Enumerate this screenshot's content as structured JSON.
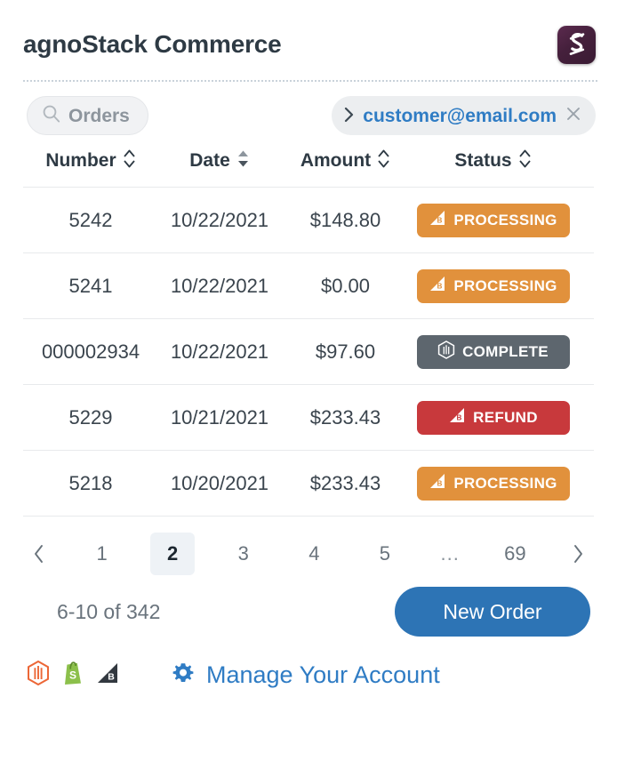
{
  "header": {
    "title": "agnoStack Commerce",
    "logo_icon": "agnostack-logo-icon",
    "logo_color": "#45203c"
  },
  "filters": {
    "search": {
      "icon": "search-icon",
      "label": "Orders",
      "placeholder": "Orders"
    },
    "customer_chip": {
      "expand_icon": "chevron-right-icon",
      "email": "customer@email.com",
      "close_icon": "close-icon",
      "link_color": "#2f7cc4"
    }
  },
  "table": {
    "columns": [
      {
        "label": "Number",
        "sort_icon": "sort-icon",
        "sort_state": "none"
      },
      {
        "label": "Date",
        "sort_icon": "sort-icon-active",
        "sort_state": "active"
      },
      {
        "label": "Amount",
        "sort_icon": "sort-icon",
        "sort_state": "none"
      },
      {
        "label": "Status",
        "sort_icon": "sort-icon",
        "sort_state": "none"
      }
    ],
    "rows": [
      {
        "number": "5242",
        "date": "10/22/2021",
        "amount": "$148.80",
        "status": "PROCESSING",
        "status_kind": "processing",
        "status_color": "#e1913c",
        "platform_icon": "bigcommerce-icon"
      },
      {
        "number": "5241",
        "date": "10/22/2021",
        "amount": "$0.00",
        "status": "PROCESSING",
        "status_kind": "processing",
        "status_color": "#e1913c",
        "platform_icon": "bigcommerce-icon"
      },
      {
        "number": "000002934",
        "date": "10/22/2021",
        "amount": "$97.60",
        "status": "COMPLETE",
        "status_kind": "complete",
        "status_color": "#5d666e",
        "platform_icon": "magento-icon"
      },
      {
        "number": "5229",
        "date": "10/21/2021",
        "amount": "$233.43",
        "status": "REFUND",
        "status_kind": "refund",
        "status_color": "#c8393c",
        "platform_icon": "bigcommerce-icon"
      },
      {
        "number": "5218",
        "date": "10/20/2021",
        "amount": "$233.43",
        "status": "PROCESSING",
        "status_kind": "processing",
        "status_color": "#e1913c",
        "platform_icon": "bigcommerce-icon"
      }
    ]
  },
  "pagination": {
    "prev_icon": "chevron-left-icon",
    "next_icon": "chevron-right-icon",
    "pages": [
      "1",
      "2",
      "3",
      "4",
      "5"
    ],
    "ellipsis": "...",
    "last_page": "69",
    "current_page": "2"
  },
  "summary": {
    "range_text": "6-10 of 342",
    "new_order_label": "New Order",
    "new_order_color": "#2d74b5"
  },
  "footer": {
    "platform_icons": [
      "magento-icon",
      "shopify-icon",
      "bigcommerce-icon"
    ],
    "manage": {
      "icon": "gear-icon",
      "label": "Manage Your Account",
      "color": "#2f7cc4"
    }
  }
}
